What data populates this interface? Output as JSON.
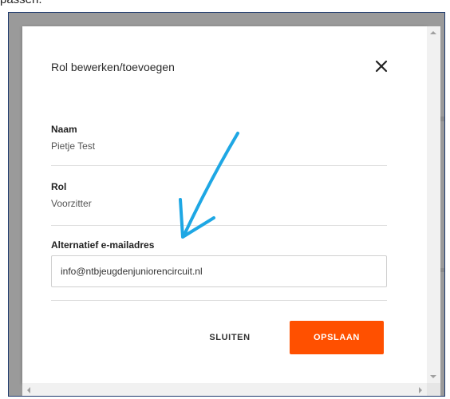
{
  "caption": "passen.",
  "dialog": {
    "title": "Rol bewerken/toevoegen",
    "close_icon": "close-icon",
    "fields": {
      "name": {
        "label": "Naam",
        "value": "Pietje Test"
      },
      "role": {
        "label": "Rol",
        "value": "Voorzitter"
      },
      "email": {
        "label": "Alternatief e-mailadres",
        "value": "info@ntbjeugdenjuniorencircuit.nl"
      }
    },
    "buttons": {
      "close_label": "SLUITEN",
      "save_label": "OPSLAAN"
    }
  },
  "colors": {
    "accent": "#ff5000",
    "annotation_arrow": "#1ea7e4",
    "backdrop": "#9a9a9a"
  }
}
